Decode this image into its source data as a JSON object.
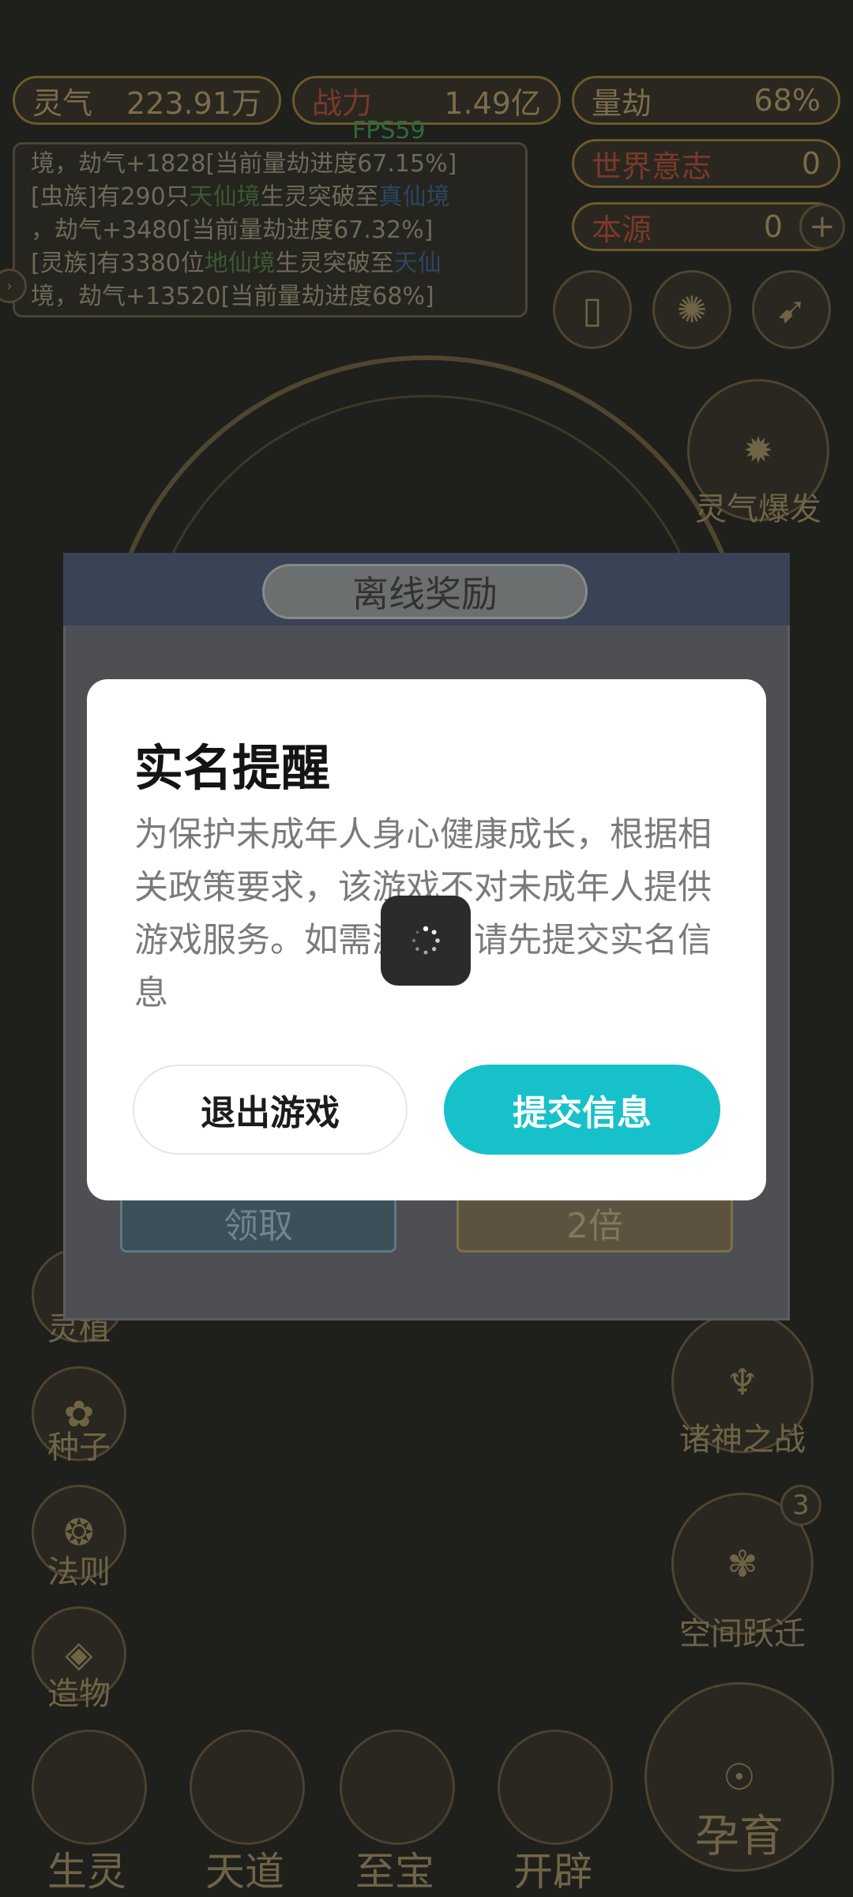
{
  "hud": {
    "lingqi": {
      "label": "灵气",
      "value": "223.91万"
    },
    "zhanli": {
      "label": "战力",
      "value": "1.49亿"
    },
    "liangjie": {
      "label": "量劫",
      "value": "68%"
    },
    "world_will": {
      "label": "世界意志",
      "value": "0"
    },
    "benyuan": {
      "label": "本源",
      "value": "0"
    },
    "fps": "FPS59"
  },
  "log": {
    "line1": "境，劫气+1828[当前量劫进度67.15%]",
    "line2a": "[虫族]有290只",
    "line2b": "天仙境",
    "line2c": "生灵突破至",
    "line2d": "真仙境",
    "line3": "，劫气+3480[当前量劫进度67.32%]",
    "line4a": "[灵族]有3380位",
    "line4b": "地仙境",
    "line4c": "生灵突破至",
    "line4d": "天仙",
    "line5": "境，劫气+13520[当前量劫进度68%]"
  },
  "side_right": {
    "lingqi_burst": "灵气爆发",
    "battle_gods": "诸神之战",
    "space_jump": "空间跃迁",
    "space_jump_badge": "3",
    "incubate": "孕育"
  },
  "side_left": {
    "item1": "灵植",
    "item2": "种子",
    "item3": "法则",
    "item4": "造物"
  },
  "bottom_nav": [
    "生灵",
    "天道",
    "至宝",
    "开辟"
  ],
  "reward": {
    "title": "离线奖励",
    "claim": "领取",
    "double": "2倍"
  },
  "modal": {
    "title": "实名提醒",
    "body": "为保护未成年人身心健康成长，根据相关政策要求，该游戏不对未成年人提供游戏服务。如需游玩，请先提交实名信息",
    "exit_label": "退出游戏",
    "submit_label": "提交信息"
  },
  "colors": {
    "accent": "#17c1c9",
    "overlay": "#1f1f1c"
  }
}
